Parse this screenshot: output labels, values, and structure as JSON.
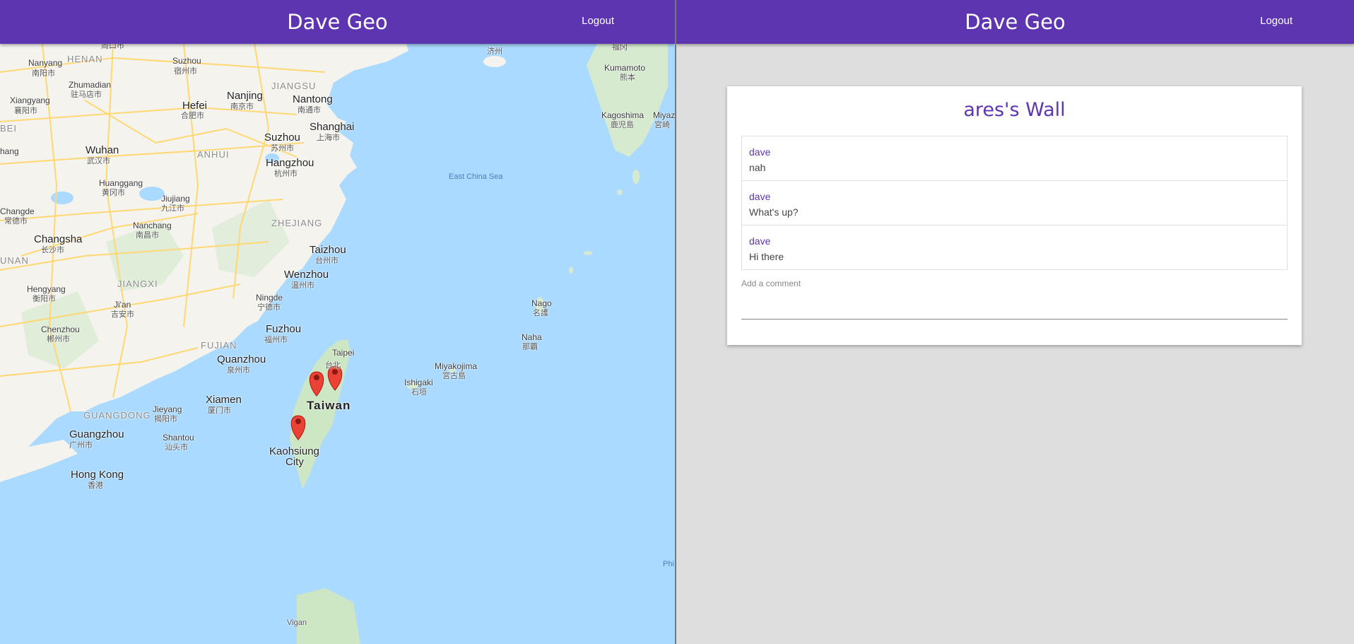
{
  "app": {
    "title": "Dave Geo",
    "logout_label": "Logout"
  },
  "map": {
    "labels": {
      "henan": "HENAN",
      "nanyang": "Nanyang",
      "nanyang_zh": "南阳市",
      "zhoukou": "周口市",
      "suzhou_n": "Suzhou",
      "suzhou_n_zh": "宿州市",
      "zhumadian": "Zhumadian",
      "zhumadian_zh": "驻马店市",
      "xiangyang": "Xiangyang",
      "xiangyang_zh": "襄阳市",
      "bei": "BEI",
      "hefei": "Hefei",
      "hefei_zh": "合肥市",
      "nanjing": "Nanjing",
      "nanjing_zh": "南京市",
      "jiangsu": "JIANGSU",
      "nantong": "Nantong",
      "nantong_zh": "南通市",
      "shanghai": "Shanghai",
      "shanghai_zh": "上海市",
      "suzhou": "Suzhou",
      "suzhou_zh": "苏州市",
      "anhui": "ANHUI",
      "wuhan": "Wuhan",
      "wuhan_zh": "武汉市",
      "hang": "hang",
      "hangzhou": "Hangzhou",
      "hangzhou_zh": "杭州市",
      "huanggang": "Huanggang",
      "huanggang_zh": "黄冈市",
      "jiujiang": "Jiujiang",
      "jiujiang_zh": "九江市",
      "zhejiang": "ZHEJIANG",
      "changde": "Changde",
      "changde_zh": "常德市",
      "nanchang": "Nanchang",
      "nanchang_zh": "南昌市",
      "changsha": "Changsha",
      "changsha_zh": "长沙市",
      "taizhou": "Taizhou",
      "taizhou_zh": "台州市",
      "unan": "UNAN",
      "wenzhou": "Wenzhou",
      "wenzhou_zh": "温州市",
      "jiangxi": "JIANGXI",
      "hengyang": "Hengyang",
      "hengyang_zh": "衡阳市",
      "jian": "Ji'an",
      "jian_zh": "吉安市",
      "ningde": "Ningde",
      "ningde_zh": "宁德市",
      "chenzhou": "Chenzhou",
      "chenzhou_zh": "郴州市",
      "fuzhou": "Fuzhou",
      "fuzhou_zh": "福州市",
      "fujian": "FUJIAN",
      "quanzhou": "Quanzhou",
      "quanzhou_zh": "泉州市",
      "taipei_fragment": "Taipei",
      "taipei_zh_fragment": "台北",
      "xiamen": "Xiamen",
      "xiamen_zh": "厦门市",
      "taiwan": "Taiwan",
      "jieyang": "Jieyang",
      "jieyang_zh": "揭阳市",
      "guangdong": "GUANGDONG",
      "guangzhou": "Guangzhou",
      "guangzhou_zh": "广州市",
      "shantou": "Shantou",
      "shantou_zh": "汕头市",
      "kaohsiung": "Kaohsiung",
      "kaohsiung_city": "City",
      "hongkong": "Hong Kong",
      "hongkong_zh": "香港",
      "east_china_sea": "East China Sea",
      "jeju_zh": "济州",
      "fukuoka_zh": "福冈",
      "kumamoto": "Kumamoto",
      "kumamoto_zh": "熊本",
      "kagoshima": "Kagoshima",
      "kagoshima_zh": "鹿児島",
      "miyazaki": "Miyaz",
      "miyazaki_zh": "宮崎",
      "nago": "Nago",
      "nago_zh": "名護",
      "naha": "Naha",
      "naha_zh": "那覇",
      "miyakojima": "Miyakojima",
      "miyakojima_zh": "宮古島",
      "ishigaki": "Ishigaki",
      "ishigaki_zh": "石垣",
      "phi": "Phi",
      "vigan": "Vigan"
    },
    "markers": [
      "map-marker-1",
      "map-marker-2",
      "map-marker-3"
    ]
  },
  "wall": {
    "title": "ares's Wall",
    "comments": [
      {
        "author": "dave",
        "text": "nah"
      },
      {
        "author": "dave",
        "text": "What's up?"
      },
      {
        "author": "dave",
        "text": "Hi there"
      }
    ],
    "add_comment_placeholder": "Add a comment"
  },
  "colors": {
    "brand": "#5e35b1",
    "sea": "#aadaff",
    "land": "#f4f3ee",
    "road": "#ffe08a"
  }
}
